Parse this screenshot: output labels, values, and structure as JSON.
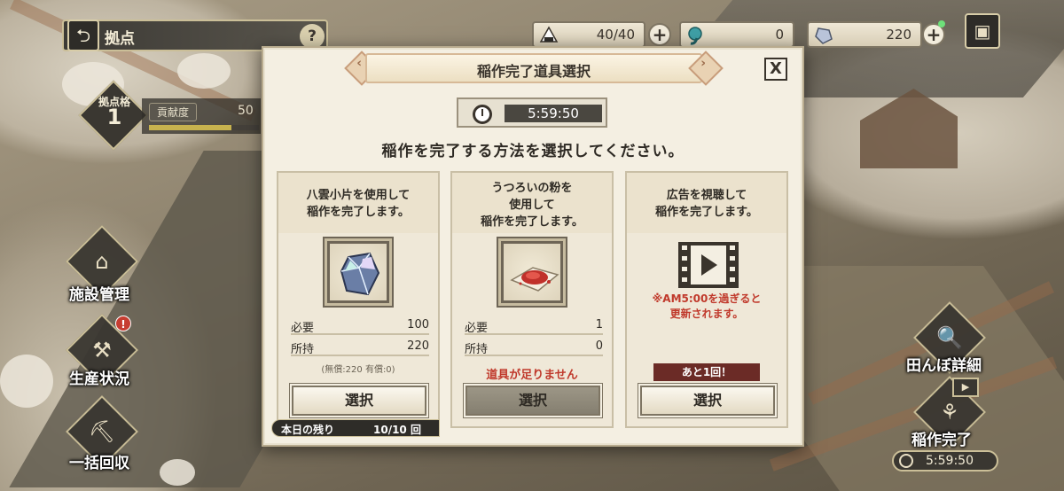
{
  "header": {
    "title": "拠点",
    "help": "?"
  },
  "resources": [
    {
      "icon": "rice-ball-icon",
      "value": "40/40"
    },
    {
      "icon": "magatama-icon",
      "value": "0"
    },
    {
      "icon": "crystal-icon",
      "value": "220"
    }
  ],
  "plus": "+",
  "base": {
    "level_label": "拠点格",
    "level": "1",
    "contrib_label": "貢献度",
    "contrib_value": "50",
    "contrib_progress": 0.75
  },
  "side_left": [
    {
      "label": "施設管理",
      "icon": "facility-icon"
    },
    {
      "label": "生産状況",
      "icon": "production-icon",
      "alert": "!"
    },
    {
      "label": "一括回収",
      "icon": "collect-icon"
    }
  ],
  "side_right": [
    {
      "label": "田んぼ詳細",
      "icon": "field-detail-icon"
    },
    {
      "label": "稲作完了",
      "icon": "rice-complete-icon"
    }
  ],
  "right_timer": "5:59:50",
  "modal": {
    "title": "稲作完了道具選択",
    "close": "X",
    "timer": "5:59:50",
    "subtitle": "稲作を完了する方法を選択してください。",
    "cards": [
      {
        "desc": "八雲小片を使用して\n稲作を完了します。",
        "item_icon": "crystal-shard-icon",
        "need_label": "必要",
        "need": "100",
        "have_label": "所持",
        "have": "220",
        "note": "(無償:220 有償:0)",
        "button": "選択",
        "enabled": true
      },
      {
        "desc": "うつろいの粉を\n使用して\n稲作を完了します。",
        "item_icon": "red-powder-icon",
        "need_label": "必要",
        "need": "1",
        "have_label": "所持",
        "have": "0",
        "warning": "道具が足りません",
        "button": "選択",
        "enabled": false
      },
      {
        "desc": "広告を視聴して\n稲作を完了します。",
        "item_icon": "video-icon",
        "ad_note": "※AM5:00を過ぎると\n更新されます。",
        "ad_remaining": "あと1回！",
        "button": "選択",
        "enabled": true
      }
    ],
    "daily_label": "本日の残り",
    "daily_value": "10/10 回"
  }
}
